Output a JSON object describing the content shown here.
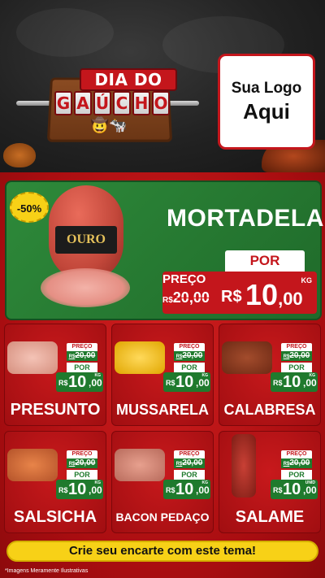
{
  "header": {
    "title_line1": "DIA DO",
    "title_letters": [
      "G",
      "A",
      "Ú",
      "C",
      "H",
      "O"
    ],
    "logo_line1": "Sua Logo",
    "logo_line2": "Aqui"
  },
  "featured": {
    "discount": "-50%",
    "package_label": "OURO",
    "name": "MORTADELA",
    "preco_label": "PREÇO",
    "old_price_currency": "R$",
    "old_price": "20,00",
    "por_label": "POR",
    "new_price_currency": "R$",
    "new_price_int": "10",
    "new_price_dec": ",00",
    "unit": "KG"
  },
  "products": [
    {
      "name": "PRESUNTO",
      "preco_label": "PREÇO",
      "old_currency": "R$",
      "old_price": "20,00",
      "por_label": "POR",
      "currency": "R$",
      "price_int": "10",
      "price_dec": ",00",
      "unit": "KG"
    },
    {
      "name": "MUSSARELA",
      "preco_label": "PREÇO",
      "old_currency": "R$",
      "old_price": "20,00",
      "por_label": "POR",
      "currency": "R$",
      "price_int": "10",
      "price_dec": ",00",
      "unit": "KG"
    },
    {
      "name": "CALABRESA",
      "preco_label": "PREÇO",
      "old_currency": "R$",
      "old_price": "20,00",
      "por_label": "POR",
      "currency": "R$",
      "price_int": "10",
      "price_dec": ",00",
      "unit": "KG"
    },
    {
      "name": "SALSICHA",
      "preco_label": "PREÇO",
      "old_currency": "R$",
      "old_price": "20,00",
      "por_label": "POR",
      "currency": "R$",
      "price_int": "10",
      "price_dec": ",00",
      "unit": "KG"
    },
    {
      "name": "BACON PEDAÇO",
      "preco_label": "PREÇO",
      "old_currency": "R$",
      "old_price": "20,00",
      "por_label": "POR",
      "currency": "R$",
      "price_int": "10",
      "price_dec": ",00",
      "unit": "KG"
    },
    {
      "name": "SALAME",
      "preco_label": "PREÇO",
      "old_currency": "R$",
      "old_price": "20,00",
      "por_label": "POR",
      "currency": "R$",
      "price_int": "10",
      "price_dec": ",00",
      "unit": "UNID"
    }
  ],
  "cta": "Crie seu encarte com este tema!",
  "disclaimer": "*Imagens Meramente Ilustrativas",
  "colors": {
    "brand_red": "#c4161c",
    "green": "#1f7a2d",
    "yellow": "#f7d117"
  }
}
